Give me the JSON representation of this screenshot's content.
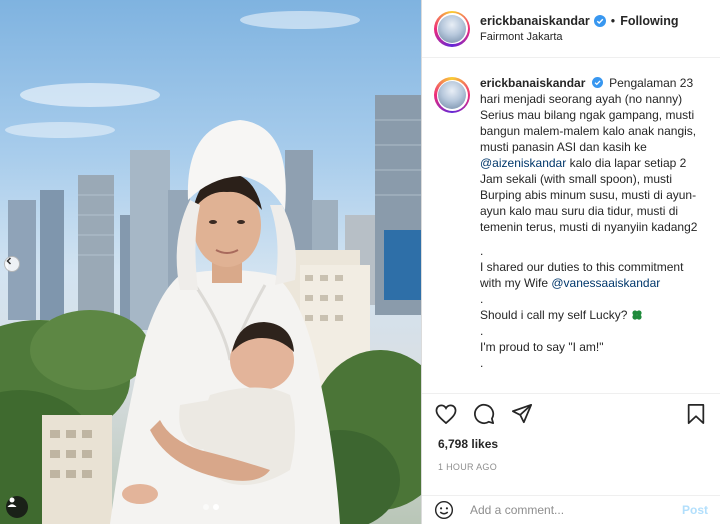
{
  "post": {
    "username": "erickbanaiskandar",
    "separator": "•",
    "follow_label": "Following",
    "location": "Fairmont Jakarta",
    "more_icon": "more-horizontal-icon"
  },
  "caption": {
    "username": "erickbanaiskandar",
    "part1": "Pengalaman 23 hari menjadi seorang ayah (no nanny) Serius mau bilang ngak gampang, musti bangun malem-malem kalo anak nangis, musti panasin ASI dan kasih ke ",
    "mention1": "@aizeniskandar",
    "part2": " kalo dia lapar setiap 2 Jam sekali (with small spoon), musti Burping abis minum susu, musti di ayun-ayun kalo mau suru dia tidur, musti di temenin terus, musti di nyanyiin kadang2",
    "dot1": ".",
    "duties": "I shared our duties to this commitment with my Wife ",
    "mention2": "@vanessaaiskandar",
    "dot2": ".",
    "lucky": "Should i call my self Lucky?",
    "dot3": ".",
    "proud": "I'm proud to say \"I am!\"",
    "dot4": "."
  },
  "stats": {
    "likes": "6,798 likes",
    "time": "1 HOUR AGO"
  },
  "comment": {
    "placeholder": "Add a comment...",
    "post_label": "Post"
  },
  "colors": {
    "verified": "#3897f0",
    "mention": "#00376b",
    "post_disabled": "#b2dffc"
  }
}
